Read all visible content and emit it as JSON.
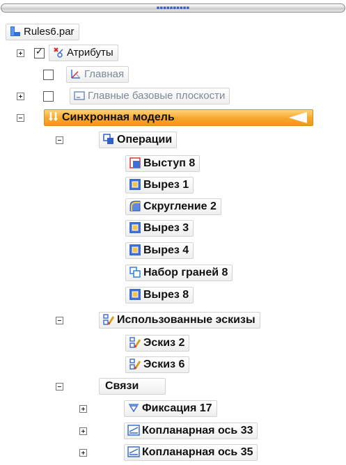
{
  "title_bar": {
    "grip": "▪▪▪▪▪▪▪▪▪▪"
  },
  "tree": {
    "root": {
      "label": "Rules6.par",
      "icon": "part-file-icon"
    },
    "attributes": {
      "label": "Атрибуты",
      "checked": true,
      "icon": "attributes-icon"
    },
    "main": {
      "label": "Главная",
      "checked": false,
      "icon": "coordinate-system-icon"
    },
    "base_planes": {
      "label": "Главные базовые плоскости",
      "checked": false,
      "icon": "plane-icon"
    },
    "sync_model": {
      "label": "Синхронная модель",
      "icon": "synchronous-icon",
      "highlight_color": "#f5a023"
    },
    "operations": {
      "label": "Операции",
      "icon": "features-icon",
      "items": [
        {
          "label": "Выступ 8",
          "icon": "protrusion-icon"
        },
        {
          "label": "Вырез 1",
          "icon": "cutout-icon"
        },
        {
          "label": "Скругление 2",
          "icon": "round-icon"
        },
        {
          "label": "Вырез 3",
          "icon": "cutout-icon"
        },
        {
          "label": "Вырез 4",
          "icon": "cutout-icon"
        },
        {
          "label": "Набор граней 8",
          "icon": "face-set-icon"
        },
        {
          "label": "Вырез 8",
          "icon": "cutout-icon"
        }
      ]
    },
    "used_sketches": {
      "label": "Использованные эскизы",
      "icon": "sketch-icon",
      "items": [
        {
          "label": "Эскиз 2",
          "icon": "sketch-icon"
        },
        {
          "label": "Эскиз 6",
          "icon": "sketch-icon"
        }
      ]
    },
    "relations": {
      "label": "Связи",
      "items": [
        {
          "label": "Фиксация 17",
          "icon": "fix-icon"
        },
        {
          "label": "Копланарная ось 33",
          "icon": "coplanar-axis-icon"
        },
        {
          "label": "Копланарная ось 35",
          "icon": "coplanar-axis-icon"
        }
      ]
    }
  }
}
